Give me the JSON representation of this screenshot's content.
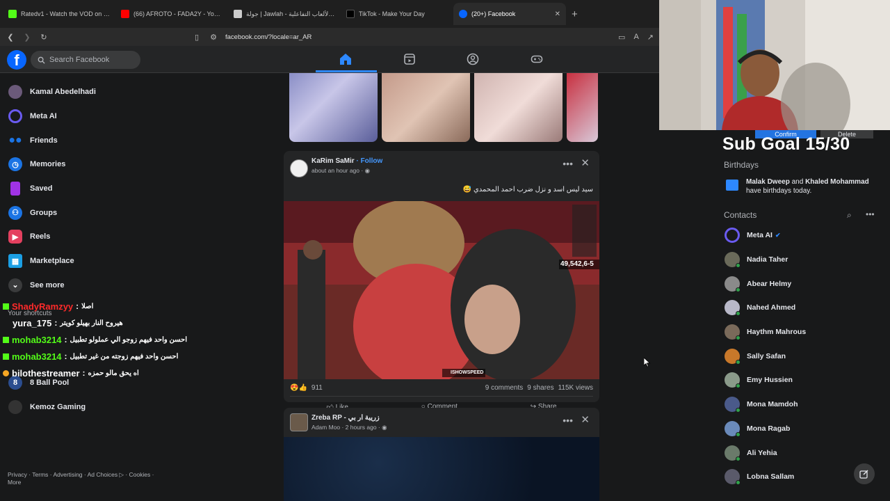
{
  "browser": {
    "tabs": [
      {
        "title": "Ratedv1 - Watch the VOD on Kick",
        "color": "#53fc18",
        "active": false
      },
      {
        "title": "(66) AFROTO - FADA2Y - YouTube",
        "color": "#ff0000",
        "active": false
      },
      {
        "title": "جولة | Jawlah - منصة الألعاب التفاعلية",
        "color": "#cccccc",
        "active": false
      },
      {
        "title": "TikTok - Make Your Day",
        "color": "#000000",
        "active": false
      },
      {
        "title": "(20+) Facebook",
        "color": "#0866ff",
        "active": true
      }
    ],
    "url": "facebook.com/?locale=ar_AR",
    "new_tab": "+"
  },
  "header": {
    "logo": "f",
    "search_placeholder": "Search Facebook",
    "nav_icons": [
      "home-icon",
      "video-icon",
      "groups-icon",
      "gaming-icon"
    ]
  },
  "left_nav": {
    "items": [
      {
        "label": "Kamal Abedelhadi",
        "icon": "avatar",
        "color": "#6b5a7a"
      },
      {
        "label": "Meta AI",
        "icon": "meta-ai-icon",
        "color": "#5b5bf0"
      },
      {
        "label": "Friends",
        "icon": "friends-icon",
        "color": "#1b74e4"
      },
      {
        "label": "Memories",
        "icon": "memories-icon",
        "color": "#1b74e4"
      },
      {
        "label": "Saved",
        "icon": "saved-icon",
        "color": "#a033e6"
      },
      {
        "label": "Groups",
        "icon": "groups-icon",
        "color": "#1b74e4"
      },
      {
        "label": "Reels",
        "icon": "reels-icon",
        "color": "#e4405f"
      },
      {
        "label": "Marketplace",
        "icon": "marketplace-icon",
        "color": "#1b9fe4"
      },
      {
        "label": "See more",
        "icon": "chevron-down-icon",
        "color": "#3a3b3c"
      }
    ],
    "shortcuts_title": "Your shortcuts",
    "shortcuts": [
      {
        "label": "8 Ball Pool",
        "color": "#2b4d8f"
      },
      {
        "label": "Kemoz Gaming",
        "color": "#333333"
      }
    ],
    "footer": "Privacy · Terms · Advertising · Ad Choices ▷ · Cookies · More"
  },
  "chat_overlay": [
    {
      "user": "ShadyRamzyy",
      "user_color": "#ff2a2a",
      "message": "اصلا"
    },
    {
      "user": "yura_175",
      "user_color": "#ffffff",
      "message": "هيروح النار بهيلو كويتر"
    },
    {
      "user": "mohab3214",
      "user_color": "#53fc18",
      "message": "احسن واحد فيهم زوجو الي عملولو تطبيل"
    },
    {
      "user": "mohab3214",
      "user_color": "#53fc18",
      "message": "احسن واحد فيهم زوجته من غير تطبيل"
    },
    {
      "user": "bilothestreamer",
      "user_color": "#ffffff",
      "message": "اه يحق مالو حمزه"
    }
  ],
  "feed": {
    "post1": {
      "author": "KaRim SaMir",
      "follow": "· Follow",
      "time": "about an hour ago · ",
      "caption": "سيد ليس اسد و نزل ضرب احمد المحمدي 😅",
      "video_overlay_number": "49,542,6-5",
      "watermark": "ISHOWSPEED",
      "reactions": "911",
      "comments": "9 comments",
      "shares": "9 shares",
      "views": "115K views",
      "actions": [
        "Like",
        "Comment",
        "Share"
      ]
    },
    "post2": {
      "author": "Zreba RP - زريبة ار بي",
      "time": "Adam Moo · 2 hours ago · "
    }
  },
  "right": {
    "sub_goal": "Sub Goal 15/30",
    "confirm": "Confirm",
    "delete": "Delete",
    "birthdays_title": "Birthdays",
    "birthday_name1": "Malak Dweep",
    "birthday_and": " and ",
    "birthday_name2": "Khaled Mohammad",
    "birthday_tail": "have birthdays today.",
    "contacts_title": "Contacts",
    "contacts": [
      {
        "name": "Meta AI",
        "color": "#5b5bf0"
      },
      {
        "name": "Nadia Taher",
        "color": "#6a6a5a"
      },
      {
        "name": "Abear Helmy",
        "color": "#8a8a8a"
      },
      {
        "name": "Nahed Ahmed",
        "color": "#b8b8c8"
      },
      {
        "name": "Haythm Mahrous",
        "color": "#7a6a5a"
      },
      {
        "name": "Sally Safan",
        "color": "#c8782a"
      },
      {
        "name": "Emy Hussien",
        "color": "#8a9a8a"
      },
      {
        "name": "Mona Mamdoh",
        "color": "#4a5a8a"
      },
      {
        "name": "Mona Ragab",
        "color": "#6a8aba"
      },
      {
        "name": "Ali Yehia",
        "color": "#6a7a6a"
      },
      {
        "name": "Lobna Sallam",
        "color": "#5a5a6a"
      }
    ]
  }
}
